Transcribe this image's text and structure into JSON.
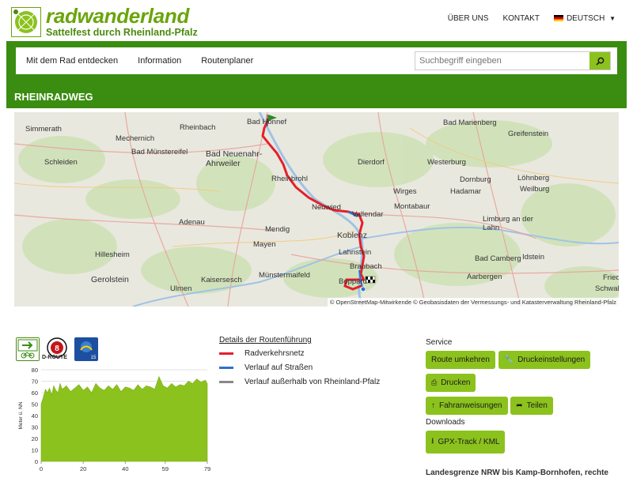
{
  "header": {
    "brand": "radwanderland",
    "tagline": "Sattelfest durch Rheinland-Pfalz",
    "links": [
      "ÜBER UNS",
      "KONTAKT"
    ],
    "language": "DEUTSCH"
  },
  "mainnav": {
    "items": [
      "Mit dem Rad entdecken",
      "Information",
      "Routenplaner"
    ],
    "search_placeholder": "Suchbegriff eingeben"
  },
  "page": {
    "title": "RHEINRADWEG"
  },
  "map": {
    "places": [
      "Simmerath",
      "Rheinbach",
      "Bad Honnef",
      "Bad Marienberg",
      "Mechernich",
      "Bad Münstereifel",
      "Bad Neuenahr-Ahrweiler",
      "Dierdorf",
      "Westerburg",
      "Greifenstein",
      "Schleiden",
      "Rheinbrohl",
      "Wirges",
      "Löhnberg",
      "Weilburg",
      "Dornburg",
      "Hadamar",
      "Neuwied",
      "Vallendar",
      "Montabaur",
      "Adenau",
      "Mendig",
      "Koblenz",
      "Limburg an der Lahn",
      "Hillesheim",
      "Mayen",
      "Lahnstein",
      "Braubach",
      "Bad Camberg",
      "Idstein",
      "Gerolstein",
      "Kaisersesch",
      "Münstermaifeld",
      "Boppard",
      "Aarbergen",
      "Ulmen",
      "Friedrichsdorf",
      "Schwalbach"
    ],
    "attribution": "© OpenStreetMap-Mitwirkende © Geobasisdaten der Vermessungs- und Katasterverwaltung Rheinland-Pfalz"
  },
  "badges": {
    "d_route_label": "D-ROUTE",
    "d_route_number": "8",
    "rheinradweg_number": "15"
  },
  "chart_data": {
    "type": "area",
    "ylabel": "Meter ü. NN",
    "xlabel": "",
    "x_ticks": [
      "0",
      "20",
      "40",
      "59",
      "79"
    ],
    "y_ticks": [
      "0",
      "10",
      "20",
      "30",
      "40",
      "50",
      "60",
      "70",
      "80"
    ],
    "xlim": [
      0,
      79
    ],
    "ylim": [
      0,
      80
    ],
    "grid": true,
    "color": "#8cc21d",
    "x": [
      0,
      1,
      2,
      3,
      4,
      5,
      6,
      7,
      8,
      9,
      10,
      12,
      14,
      16,
      18,
      20,
      22,
      24,
      26,
      28,
      30,
      32,
      34,
      36,
      38,
      40,
      42,
      44,
      46,
      48,
      50,
      52,
      54,
      56,
      58,
      60,
      62,
      64,
      66,
      68,
      70,
      72,
      74,
      76,
      78,
      79
    ],
    "y": [
      50,
      56,
      63,
      60,
      64,
      58,
      66,
      62,
      60,
      68,
      63,
      66,
      61,
      64,
      67,
      62,
      65,
      60,
      68,
      64,
      62,
      66,
      63,
      67,
      61,
      65,
      64,
      62,
      67,
      63,
      66,
      65,
      63,
      74,
      66,
      64,
      68,
      65,
      67,
      66,
      70,
      68,
      72,
      69,
      71,
      68
    ]
  },
  "legend": {
    "title": "Details der Routenführung",
    "items": [
      {
        "label": "Radverkehrsnetz",
        "color": "#e4202a"
      },
      {
        "label": "Verlauf auf Straßen",
        "color": "#2f6fd1"
      },
      {
        "label": "Verlauf außerhalb von Rheinland-Pfalz",
        "color": "#888888"
      }
    ]
  },
  "service": {
    "heading": "Service",
    "buttons": [
      "Route umkehren",
      "Druckeinstellungen",
      "Drucken",
      "Fahranweisungen",
      "Teilen"
    ],
    "downloads_heading": "Downloads",
    "download_button": "GPX-Track / KML"
  },
  "section": {
    "route_description": "Landesgrenze NRW bis Kamp-Bornhofen, rechte"
  }
}
